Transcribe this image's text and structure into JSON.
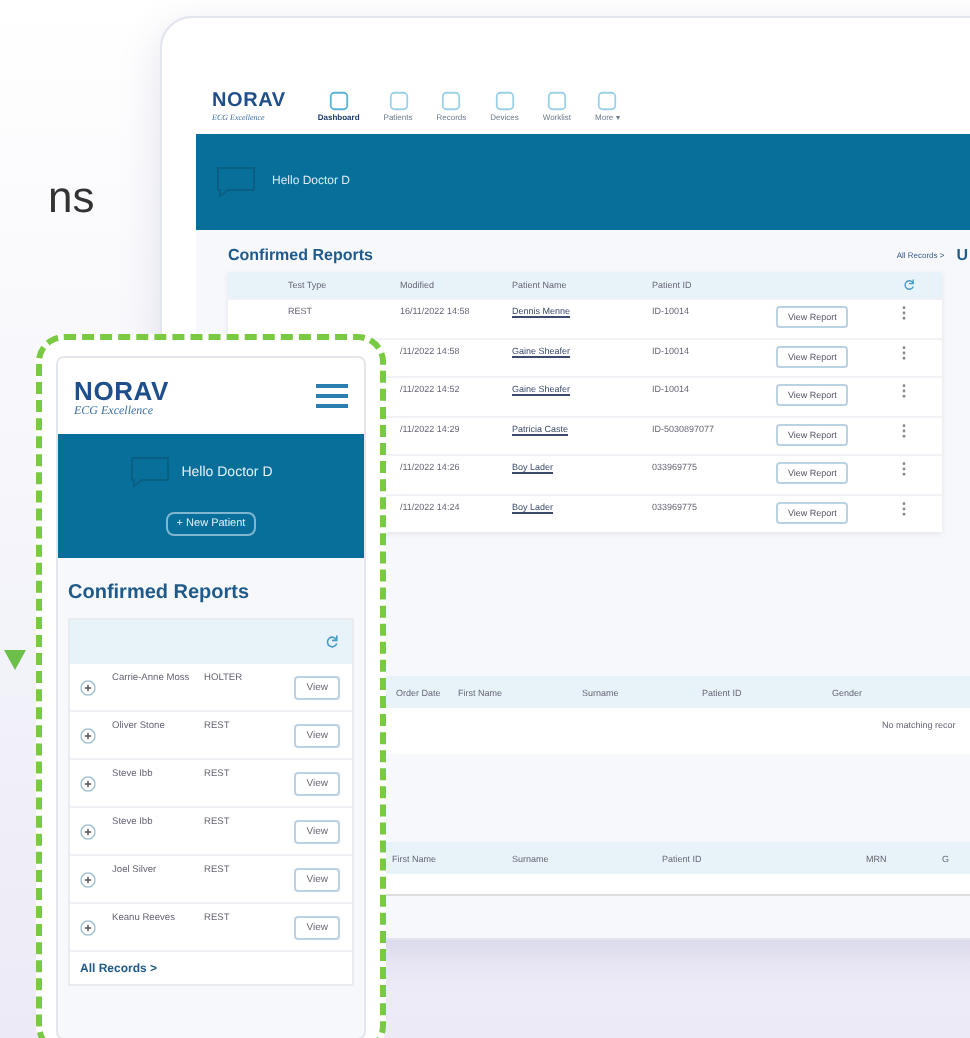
{
  "caption_fragment": "ns",
  "desktop": {
    "logo": "NORAV",
    "tagline": "ECG Excellence",
    "nav": [
      {
        "label": "Dashboard",
        "selected": true
      },
      {
        "label": "Patients",
        "selected": false
      },
      {
        "label": "Records",
        "selected": false
      },
      {
        "label": "Devices",
        "selected": false
      },
      {
        "label": "Worklist",
        "selected": false
      },
      {
        "label": "More ▾",
        "selected": false
      }
    ],
    "greeting": "Hello Doctor D",
    "section_title": "Confirmed Reports",
    "all_records": "All Records >",
    "next_title": "U",
    "columns": [
      "Test Type",
      "Modified",
      "Patient Name",
      "Patient ID"
    ],
    "rows": [
      {
        "test_type": "REST",
        "modified": "16/11/2022 14:58",
        "name": "Dennis Menne",
        "patient_id": "ID-10014",
        "action": "View Report"
      },
      {
        "test_type": "",
        "modified": "/11/2022 14:58",
        "name": "Gaine Sheafer",
        "patient_id": "ID-10014",
        "action": "View Report"
      },
      {
        "test_type": "",
        "modified": "/11/2022 14:52",
        "name": "Gaine Sheafer",
        "patient_id": "ID-10014",
        "action": "View Report"
      },
      {
        "test_type": "",
        "modified": "/11/2022 14:29",
        "name": "Patricia Caste",
        "patient_id": "ID-5030897077",
        "action": "View Report"
      },
      {
        "test_type": "",
        "modified": "/11/2022 14:26",
        "name": "Boy Lader",
        "patient_id": "033969775",
        "action": "View Report"
      },
      {
        "test_type": "",
        "modified": "/11/2022 14:24",
        "name": "Boy Lader",
        "patient_id": "033969775",
        "action": "View Report"
      }
    ],
    "orders_columns": [
      "Order Date",
      "First Name",
      "Surname",
      "Patient ID",
      "Gender"
    ],
    "orders_empty": "No matching recor",
    "patients_columns": [
      "First Name",
      "Surname",
      "Patient ID",
      "MRN",
      "G"
    ]
  },
  "mobile": {
    "logo": "NORAV",
    "tagline": "ECG Excellence",
    "greeting": "Hello Doctor D",
    "new_patient": "+ New Patient",
    "section_title": "Confirmed Reports",
    "rows": [
      {
        "name": "Carrie-Anne Moss",
        "test_type": "HOLTER",
        "action": "View"
      },
      {
        "name": "Oliver Stone",
        "test_type": "REST",
        "action": "View"
      },
      {
        "name": "Steve Ibb",
        "test_type": "REST",
        "action": "View"
      },
      {
        "name": "Steve Ibb",
        "test_type": "REST",
        "action": "View"
      },
      {
        "name": "Joel Silver",
        "test_type": "REST",
        "action": "View"
      },
      {
        "name": "Keanu Reeves",
        "test_type": "REST",
        "action": "View"
      }
    ],
    "all_records": "All Records >"
  }
}
